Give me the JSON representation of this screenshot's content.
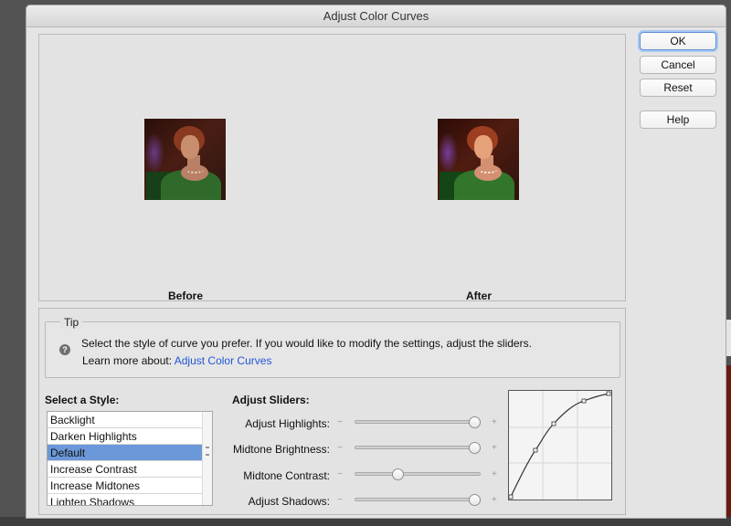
{
  "dialog": {
    "title": "Adjust Color Curves"
  },
  "preview": {
    "before_label": "Before",
    "after_label": "After"
  },
  "buttons": {
    "ok": "OK",
    "cancel": "Cancel",
    "reset": "Reset",
    "help": "Help"
  },
  "tip": {
    "title": "Tip",
    "text": "Select the style of curve you prefer. If you would like to modify the settings, adjust the sliders.",
    "learn_prefix": "Learn more about: ",
    "learn_link": "Adjust Color Curves"
  },
  "styles": {
    "heading": "Select a Style:",
    "selected": "Default",
    "items": [
      {
        "label": "Backlight"
      },
      {
        "label": "Darken Highlights"
      },
      {
        "label": "Default"
      },
      {
        "label": "Increase Contrast"
      },
      {
        "label": "Increase Midtones"
      },
      {
        "label": "Lighten Shadows"
      }
    ]
  },
  "sliders": {
    "heading": "Adjust Sliders:",
    "minus": "−",
    "plus": "+",
    "items": [
      {
        "label": "Adjust Highlights:",
        "value": 1.0
      },
      {
        "label": "Midtone Brightness:",
        "value": 1.0
      },
      {
        "label": "Midtone Contrast:",
        "value": 0.33
      },
      {
        "label": "Adjust Shadows:",
        "value": 1.0
      }
    ]
  },
  "icons": {
    "tip": "question-icon"
  },
  "colors": {
    "link": "#2156d6",
    "selection": "#6b98d8",
    "ok_focus": "#a9c8f2"
  }
}
